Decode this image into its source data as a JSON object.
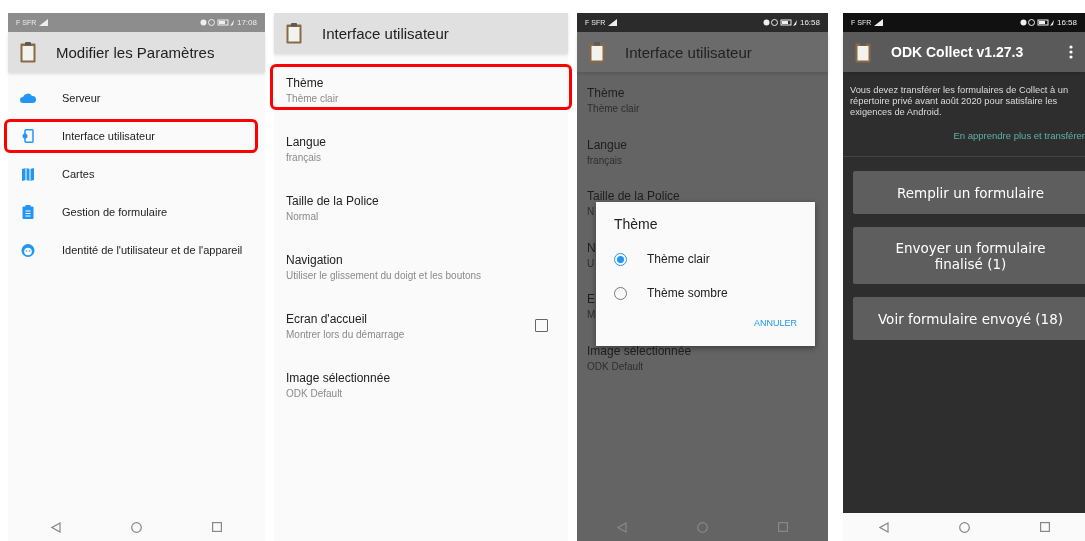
{
  "panels": [
    {
      "kind": "menu",
      "dimmed": false,
      "status_bar": {
        "carrier": "F SFR",
        "time": "17:08"
      },
      "title": "Modifier les Paramètres",
      "nav_bar": true,
      "items": [
        {
          "label": "Serveur",
          "highlighted": false
        },
        {
          "label": "Interface utilisateur",
          "highlighted": true
        },
        {
          "label": "Cartes",
          "highlighted": false
        },
        {
          "label": "Gestion de formulaire",
          "highlighted": false
        },
        {
          "label": "Identité de l'utilisateur et de l'appareil",
          "highlighted": false
        }
      ]
    },
    {
      "kind": "prefs",
      "dimmed": false,
      "title": "Interface utilisateur",
      "nav_bar": false,
      "items": [
        {
          "kind": "text",
          "title": "Thème",
          "subtitle": "Thème clair",
          "highlighted": true
        },
        {
          "kind": "text",
          "title": "Langue",
          "subtitle": "français",
          "highlighted": false
        },
        {
          "kind": "text",
          "title": "Taille de la Police",
          "subtitle": "Normal",
          "highlighted": false
        },
        {
          "kind": "text",
          "title": "Navigation",
          "subtitle": "Utiliser le glissement du doigt et les boutons",
          "highlighted": false
        },
        {
          "kind": "checkbox",
          "title": "Ecran d'accueil",
          "subtitle": "Montrer lors du démarrage",
          "checked": false,
          "highlighted": false
        },
        {
          "kind": "text",
          "title": "Image sélectionnée",
          "subtitle": "ODK Default",
          "highlighted": false
        }
      ]
    },
    {
      "kind": "prefs",
      "dimmed": true,
      "status_bar": {
        "carrier": "F SFR",
        "time": "16:58"
      },
      "title": "Interface utilisateur",
      "nav_bar": true,
      "items": [
        {
          "kind": "text",
          "title": "Thème",
          "subtitle": "Thème clair",
          "highlighted": false
        },
        {
          "kind": "text",
          "title": "Langue",
          "subtitle": "français",
          "highlighted": false
        },
        {
          "kind": "text",
          "title": "Taille de la Police",
          "subtitle": "N",
          "highlighted": false
        },
        {
          "kind": "text",
          "title": "N",
          "subtitle": "U",
          "highlighted": false
        },
        {
          "kind": "text",
          "title": "E",
          "subtitle": "M",
          "highlighted": false
        },
        {
          "kind": "text",
          "title": "Image sélectionnée",
          "subtitle": "ODK Default",
          "highlighted": false
        }
      ],
      "dialog": {
        "title": "Thème",
        "options": [
          {
            "label": "Thème clair",
            "selected": true
          },
          {
            "label": "Thème sombre",
            "selected": false
          }
        ],
        "button": "ANNULER"
      }
    },
    {
      "kind": "home",
      "dimmed": false,
      "status_bar": {
        "carrier": "F SFR",
        "time": "16:58"
      },
      "title": "ODK Collect v1.27.3",
      "nav_bar": true,
      "message": "Vous devez transférer les formulaires de Collect à un répertoire privé avant août 2020 pour satisfaire les exigences de Android.",
      "link": "En apprendre plus et transférer",
      "buttons": [
        "Remplir un formulaire",
        "Envoyer un formulaire finalisé (1)",
        "Voir formulaire envoyé (18)"
      ]
    }
  ]
}
